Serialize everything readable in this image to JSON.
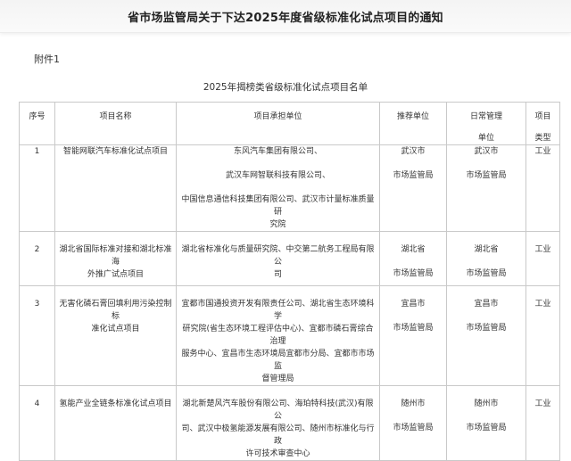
{
  "title": "省市场监管局关于下达2025年度省级标准化试点项目的通知",
  "attachment_label": "附件1",
  "table_title": "2025年揭榜类省级标准化试点项目名单",
  "headers": {
    "seq": "序号",
    "name": "项目名称",
    "unit": "项目承担单位",
    "recommend": "推荐单位",
    "daily_line1": "日常管理",
    "daily_line2": "单位",
    "type_line1": "项目",
    "type_line2": "类型"
  },
  "rows": [
    {
      "seq": "1",
      "name": "智能网联汽车标准化试点项目",
      "unit_lines": [
        "东风汽车集团有限公司、",
        "武汉车网智联科技有限公司、",
        "中国信息通信科技集团有限公司、武汉市计量标准质量研",
        "究院"
      ],
      "recommend": [
        "武汉市",
        "市场监管局"
      ],
      "daily": [
        "武汉市",
        "市场监管局"
      ],
      "type": "工业"
    },
    {
      "seq": "2",
      "name_lines": [
        "湖北省国际标准对接和湖北标准海",
        "外推广试点项目"
      ],
      "unit_lines": [
        "湖北省标准化与质量研究院、中交第二航务工程局有限公",
        "司"
      ],
      "recommend": [
        "湖北省",
        "市场监管局"
      ],
      "daily": [
        "湖北省",
        "市场监管局"
      ],
      "type": "工业"
    },
    {
      "seq": "3",
      "name_lines": [
        "无害化磷石膏回填利用污染控制标",
        "准化试点项目"
      ],
      "unit_lines": [
        "宜都市国通投资开发有限责任公司、湖北省生态环境科学",
        "研究院(省生态环境工程评估中心)、宜都市磷石膏综合治理",
        "服务中心、宜昌市生态环境局宜都市分局、宜都市市场监",
        "督管理局"
      ],
      "recommend": [
        "宜昌市",
        "市场监管局"
      ],
      "daily": [
        "宜昌市",
        "市场监管局"
      ],
      "type": "工业"
    },
    {
      "seq": "4",
      "name": "氢能产业全链条标准化试点项目",
      "unit_lines": [
        "湖北新楚风汽车股份有限公司、海珀特科技(武汉)有限公",
        "司、武汉中极氢能源发展有限公司、随州市标准化与行政",
        "许可技术审查中心"
      ],
      "recommend": [
        "随州市",
        "市场监管局"
      ],
      "daily": [
        "随州市",
        "市场监管局"
      ],
      "type": "工业"
    }
  ]
}
